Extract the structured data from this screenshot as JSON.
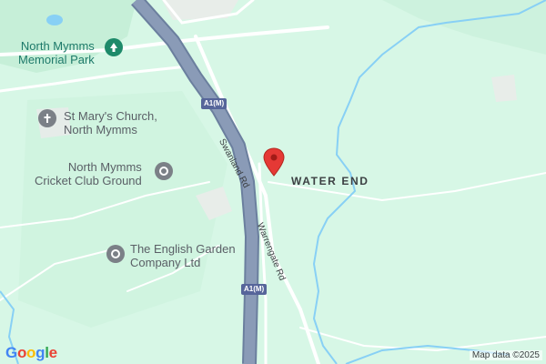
{
  "map": {
    "colors": {
      "land": "#d7f7e6",
      "park": "#c6efd8",
      "motorway": "#8a9bb7",
      "motorway_edge": "#6b7f9e",
      "water": "#88d0f5",
      "road": "#ffffff",
      "poi_park": "#1e8a6a",
      "poi_grey": "#7b8087",
      "pin": "#e53935"
    },
    "pois": {
      "park": {
        "line1": "North Mymms",
        "line2": "Memorial Park",
        "icon": "tree-icon"
      },
      "church": {
        "line1": "St Mary's Church,",
        "line2": "North Mymms",
        "icon": "cross-icon"
      },
      "cricket": {
        "line1": "North Mymms",
        "line2": "Cricket Club Ground",
        "icon": "landmark-icon"
      },
      "garden": {
        "line1": "The English Garden",
        "line2": "Company Ltd",
        "icon": "landmark-icon"
      }
    },
    "place": {
      "name": "WATER END"
    },
    "roads": {
      "swanland": "Swanland Rd",
      "warrengate": "Warrengate Rd"
    },
    "shields": {
      "a1_top": "A1(M)",
      "a1_bottom": "A1(M)"
    },
    "pin": {
      "icon": "location-pin-icon"
    },
    "branding": {
      "logo_letters": [
        {
          "ch": "G",
          "color": "#4285F4"
        },
        {
          "ch": "o",
          "color": "#EA4335"
        },
        {
          "ch": "o",
          "color": "#FBBC05"
        },
        {
          "ch": "g",
          "color": "#4285F4"
        },
        {
          "ch": "l",
          "color": "#34A853"
        },
        {
          "ch": "e",
          "color": "#EA4335"
        }
      ],
      "attribution": "Map data ©2025"
    }
  }
}
